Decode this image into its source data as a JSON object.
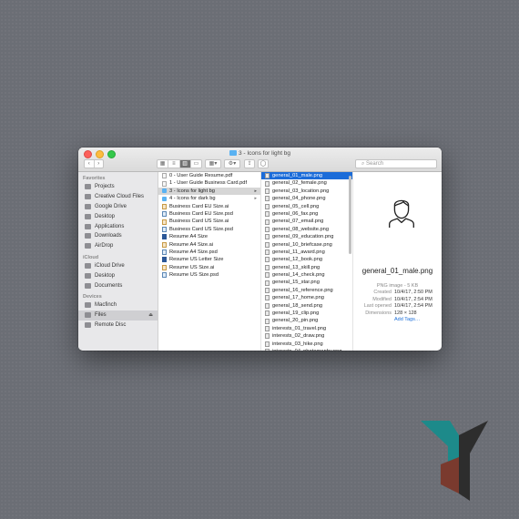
{
  "window": {
    "title": "3 - Icons for light bg"
  },
  "toolbar": {
    "back": "‹",
    "forward": "›",
    "search_placeholder": "Search"
  },
  "sidebar": {
    "sections": [
      {
        "label": "Favorites",
        "items": [
          {
            "label": "Projects",
            "icon": "folder-icon"
          },
          {
            "label": "Creative Cloud Files",
            "icon": "creative-cloud-icon"
          },
          {
            "label": "Google Drive",
            "icon": "google-drive-icon"
          },
          {
            "label": "Desktop",
            "icon": "desktop-icon"
          },
          {
            "label": "Applications",
            "icon": "applications-icon"
          },
          {
            "label": "Downloads",
            "icon": "downloads-icon"
          },
          {
            "label": "AirDrop",
            "icon": "airdrop-icon"
          }
        ]
      },
      {
        "label": "iCloud",
        "items": [
          {
            "label": "iCloud Drive",
            "icon": "cloud-icon"
          },
          {
            "label": "Desktop",
            "icon": "desktop-icon"
          },
          {
            "label": "Documents",
            "icon": "documents-icon"
          }
        ]
      },
      {
        "label": "Devices",
        "items": [
          {
            "label": "Macfinch",
            "icon": "laptop-icon"
          },
          {
            "label": "Files",
            "icon": "disk-icon",
            "selected": true,
            "eject": "⏏"
          },
          {
            "label": "Remote Disc",
            "icon": "disc-icon"
          }
        ]
      }
    ]
  },
  "column1": [
    {
      "label": "0 - User Guide Resume.pdf",
      "type": "file"
    },
    {
      "label": "1 - User Guide Business Card.pdf",
      "type": "file"
    },
    {
      "label": "3 - Icons for light bg",
      "type": "folder",
      "selected": true,
      "arrow": "▸"
    },
    {
      "label": "4 - Icons for dark bg",
      "type": "folder",
      "arrow": "▸"
    },
    {
      "label": "Business Card EU Size.ai",
      "type": "ai"
    },
    {
      "label": "Business Card EU Size.psd",
      "type": "psd"
    },
    {
      "label": "Business Card US Size.ai",
      "type": "ai"
    },
    {
      "label": "Business Card US Size.psd",
      "type": "psd"
    },
    {
      "label": "Resume A4 Size",
      "type": "word"
    },
    {
      "label": "Resume A4 Size.ai",
      "type": "ai"
    },
    {
      "label": "Resume A4 Size.psd",
      "type": "psd"
    },
    {
      "label": "Resume US Letter Size",
      "type": "word"
    },
    {
      "label": "Resume US Size.ai",
      "type": "ai"
    },
    {
      "label": "Resume US Size.psd",
      "type": "psd"
    }
  ],
  "column2": [
    "general_01_male.png",
    "general_02_female.png",
    "general_03_location.png",
    "general_04_phone.png",
    "general_05_cell.png",
    "general_06_fax.png",
    "general_07_email.png",
    "general_08_website.png",
    "general_09_education.png",
    "general_10_briefcase.png",
    "general_11_award.png",
    "general_12_book.png",
    "general_13_skill.png",
    "general_14_check.png",
    "general_15_star.png",
    "general_16_reference.png",
    "general_17_home.png",
    "general_18_send.png",
    "general_19_clip.png",
    "general_20_pin.png",
    "interests_01_travel.png",
    "interests_02_draw.png",
    "interests_03_hike.png",
    "interests_04_photography.png"
  ],
  "preview": {
    "name": "general_01_male.png",
    "kind": "PNG image - 5 KB",
    "rows": [
      {
        "k": "Created",
        "v": "10/4/17, 2:50 PM"
      },
      {
        "k": "Modified",
        "v": "10/4/17, 2:54 PM"
      },
      {
        "k": "Last opened",
        "v": "10/4/17, 2:54 PM"
      },
      {
        "k": "Dimensions",
        "v": "128 × 128"
      }
    ],
    "add_tags": "Add Tags…"
  },
  "colors": {
    "accent": "#1b6cd9",
    "logo_teal": "#1d8a8a",
    "logo_dark": "#333333",
    "logo_red": "#8b3a2e"
  }
}
